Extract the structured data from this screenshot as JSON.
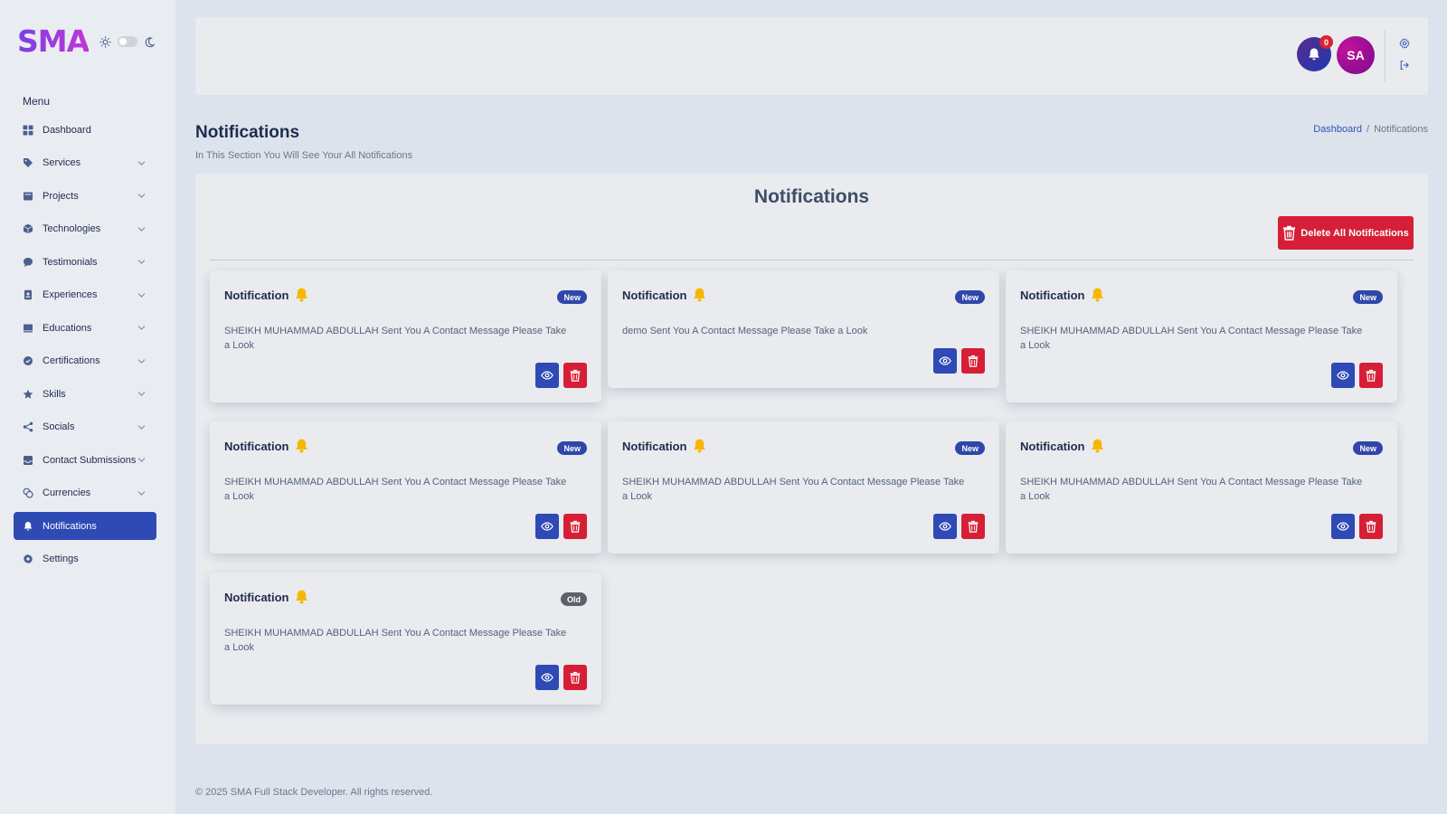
{
  "brand": {
    "logo": "SMA"
  },
  "sidebar": {
    "menu_heading": "Menu",
    "items": [
      {
        "label": "Dashboard",
        "icon": "grid-icon",
        "has_chevron": false,
        "active": false
      },
      {
        "label": "Services",
        "icon": "tag-icon",
        "has_chevron": true,
        "active": false
      },
      {
        "label": "Projects",
        "icon": "folder-icon",
        "has_chevron": true,
        "active": false
      },
      {
        "label": "Technologies",
        "icon": "box-icon",
        "has_chevron": true,
        "active": false
      },
      {
        "label": "Testimonials",
        "icon": "chat-icon",
        "has_chevron": true,
        "active": false
      },
      {
        "label": "Experiences",
        "icon": "id-badge-icon",
        "has_chevron": true,
        "active": false
      },
      {
        "label": "Educations",
        "icon": "book-icon",
        "has_chevron": true,
        "active": false
      },
      {
        "label": "Certifications",
        "icon": "certificate-icon",
        "has_chevron": true,
        "active": false
      },
      {
        "label": "Skills",
        "icon": "star-icon",
        "has_chevron": true,
        "active": false
      },
      {
        "label": "Socials",
        "icon": "share-icon",
        "has_chevron": true,
        "active": false
      },
      {
        "label": "Contact Submissions",
        "icon": "inbox-icon",
        "has_chevron": true,
        "active": false
      },
      {
        "label": "Currencies",
        "icon": "coins-icon",
        "has_chevron": true,
        "active": false
      },
      {
        "label": "Notifications",
        "icon": "bell-icon",
        "has_chevron": false,
        "active": true
      },
      {
        "label": "Settings",
        "icon": "gear-icon",
        "has_chevron": false,
        "active": false
      }
    ]
  },
  "topbar": {
    "notification_count": "0",
    "avatar_initials": "SA"
  },
  "page": {
    "title": "Notifications",
    "subtitle": "In This Section You Will See Your All Notifications",
    "breadcrumb": {
      "link": "Dashboard",
      "separator": "/",
      "current": "Notifications"
    }
  },
  "panel": {
    "title": "Notifications",
    "delete_all_label": "Delete All Notifications"
  },
  "notifications": [
    {
      "title": "Notification",
      "badge": "New",
      "message": "SHEIKH MUHAMMAD ABDULLAH Sent You A Contact Message Please Take a Look"
    },
    {
      "title": "Notification",
      "badge": "New",
      "message": "demo Sent You A Contact Message Please Take a Look"
    },
    {
      "title": "Notification",
      "badge": "New",
      "message": "SHEIKH MUHAMMAD ABDULLAH Sent You A Contact Message Please Take a Look"
    },
    {
      "title": "Notification",
      "badge": "New",
      "message": "SHEIKH MUHAMMAD ABDULLAH Sent You A Contact Message Please Take a Look"
    },
    {
      "title": "Notification",
      "badge": "New",
      "message": "SHEIKH MUHAMMAD ABDULLAH Sent You A Contact Message Please Take a Look"
    },
    {
      "title": "Notification",
      "badge": "New",
      "message": "SHEIKH MUHAMMAD ABDULLAH Sent You A Contact Message Please Take a Look"
    },
    {
      "title": "Notification",
      "badge": "Old",
      "message": "SHEIKH MUHAMMAD ABDULLAH Sent You A Contact Message Please Take a Look"
    }
  ],
  "footer": {
    "text": "© 2025 SMA Full Stack Developer. All rights reserved."
  },
  "colors": {
    "primary": "#2f49b5",
    "danger": "#d61f36",
    "badge_new": "#2f47a8",
    "badge_old": "#5c6169",
    "bell_yellow": "#f5b800"
  }
}
